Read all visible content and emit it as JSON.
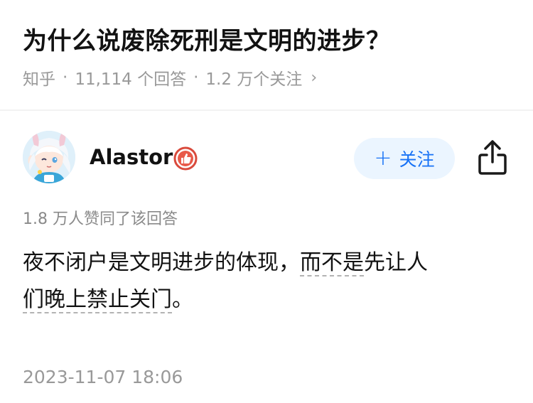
{
  "question": {
    "title": "为什么说废除死刑是文明的进步？",
    "source": "知乎",
    "answers_count": "11,114 个回答",
    "followers": "1.2 万个关注",
    "chevron": "›"
  },
  "author": {
    "name": "Alastor",
    "avatar_icon": "anime-avatar-icon",
    "badge_icon": "thumbs-up-badge-icon",
    "follow_plus": "+",
    "follow_label": "关注",
    "share_icon": "share-icon"
  },
  "answer": {
    "vote_info": "1.8 万人赞同了该回答",
    "line1_part1": "夜不闭户是文明进步的体现，",
    "line1_keyword": "而不是",
    "line1_part2": "先让人",
    "line2_keyword": "们晚上禁止关门",
    "line2_end": "。",
    "timestamp": "2023-11-07 18:06"
  },
  "colors": {
    "accent": "#1772f6",
    "follow_bg": "#ebf5ff",
    "meta_gray": "#999999",
    "badge_red": "#d94a3c"
  }
}
